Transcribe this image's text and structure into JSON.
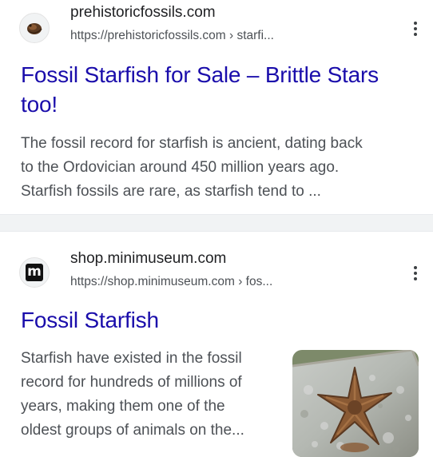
{
  "results": [
    {
      "site_name": "prehistoricfossils.com",
      "url": "https://prehistoricfossils.com",
      "url_path": " › starfi...",
      "title_line1": "Fossil Starfish for Sale – Brittle Stars",
      "title_line2": "too!",
      "snippet_lines": [
        "The fossil record for starfish is ancient, dating back",
        "to the Ordovician around 450 million years ago.",
        "Starfish fossils are rare, as starfish tend to ..."
      ],
      "favicon": "trilobite-logo-icon"
    },
    {
      "site_name": "shop.minimuseum.com",
      "url": "https://shop.minimuseum.com",
      "url_path": " › fos...",
      "title": "Fossil Starfish",
      "favicon_letter": "m",
      "snippet_lines": [
        "Starfish have existed in the fossil",
        "record for hundreds of millions of",
        "years, making them one of the",
        "oldest groups of animals on the..."
      ],
      "thumbnail": "starfish-fossil-image"
    }
  ],
  "colors": {
    "link": "#1a0dab",
    "snippet": "#4d5156",
    "site_name": "#202124",
    "divider": "#f1f3f4"
  }
}
